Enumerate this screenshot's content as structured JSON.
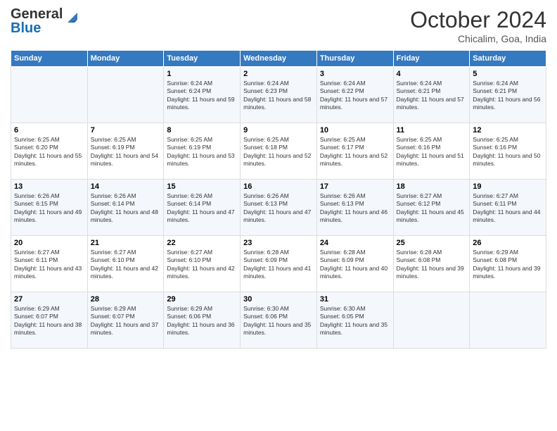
{
  "header": {
    "logo_general": "General",
    "logo_blue": "Blue",
    "month": "October 2024",
    "location": "Chicalim, Goa, India"
  },
  "days_of_week": [
    "Sunday",
    "Monday",
    "Tuesday",
    "Wednesday",
    "Thursday",
    "Friday",
    "Saturday"
  ],
  "weeks": [
    [
      {
        "day": "",
        "detail": ""
      },
      {
        "day": "",
        "detail": ""
      },
      {
        "day": "1",
        "detail": "Sunrise: 6:24 AM\nSunset: 6:24 PM\nDaylight: 11 hours and 59 minutes."
      },
      {
        "day": "2",
        "detail": "Sunrise: 6:24 AM\nSunset: 6:23 PM\nDaylight: 11 hours and 58 minutes."
      },
      {
        "day": "3",
        "detail": "Sunrise: 6:24 AM\nSunset: 6:22 PM\nDaylight: 11 hours and 57 minutes."
      },
      {
        "day": "4",
        "detail": "Sunrise: 6:24 AM\nSunset: 6:21 PM\nDaylight: 11 hours and 57 minutes."
      },
      {
        "day": "5",
        "detail": "Sunrise: 6:24 AM\nSunset: 6:21 PM\nDaylight: 11 hours and 56 minutes."
      }
    ],
    [
      {
        "day": "6",
        "detail": "Sunrise: 6:25 AM\nSunset: 6:20 PM\nDaylight: 11 hours and 55 minutes."
      },
      {
        "day": "7",
        "detail": "Sunrise: 6:25 AM\nSunset: 6:19 PM\nDaylight: 11 hours and 54 minutes."
      },
      {
        "day": "8",
        "detail": "Sunrise: 6:25 AM\nSunset: 6:19 PM\nDaylight: 11 hours and 53 minutes."
      },
      {
        "day": "9",
        "detail": "Sunrise: 6:25 AM\nSunset: 6:18 PM\nDaylight: 11 hours and 52 minutes."
      },
      {
        "day": "10",
        "detail": "Sunrise: 6:25 AM\nSunset: 6:17 PM\nDaylight: 11 hours and 52 minutes."
      },
      {
        "day": "11",
        "detail": "Sunrise: 6:25 AM\nSunset: 6:16 PM\nDaylight: 11 hours and 51 minutes."
      },
      {
        "day": "12",
        "detail": "Sunrise: 6:25 AM\nSunset: 6:16 PM\nDaylight: 11 hours and 50 minutes."
      }
    ],
    [
      {
        "day": "13",
        "detail": "Sunrise: 6:26 AM\nSunset: 6:15 PM\nDaylight: 11 hours and 49 minutes."
      },
      {
        "day": "14",
        "detail": "Sunrise: 6:26 AM\nSunset: 6:14 PM\nDaylight: 11 hours and 48 minutes."
      },
      {
        "day": "15",
        "detail": "Sunrise: 6:26 AM\nSunset: 6:14 PM\nDaylight: 11 hours and 47 minutes."
      },
      {
        "day": "16",
        "detail": "Sunrise: 6:26 AM\nSunset: 6:13 PM\nDaylight: 11 hours and 47 minutes."
      },
      {
        "day": "17",
        "detail": "Sunrise: 6:26 AM\nSunset: 6:13 PM\nDaylight: 11 hours and 46 minutes."
      },
      {
        "day": "18",
        "detail": "Sunrise: 6:27 AM\nSunset: 6:12 PM\nDaylight: 11 hours and 45 minutes."
      },
      {
        "day": "19",
        "detail": "Sunrise: 6:27 AM\nSunset: 6:11 PM\nDaylight: 11 hours and 44 minutes."
      }
    ],
    [
      {
        "day": "20",
        "detail": "Sunrise: 6:27 AM\nSunset: 6:11 PM\nDaylight: 11 hours and 43 minutes."
      },
      {
        "day": "21",
        "detail": "Sunrise: 6:27 AM\nSunset: 6:10 PM\nDaylight: 11 hours and 42 minutes."
      },
      {
        "day": "22",
        "detail": "Sunrise: 6:27 AM\nSunset: 6:10 PM\nDaylight: 11 hours and 42 minutes."
      },
      {
        "day": "23",
        "detail": "Sunrise: 6:28 AM\nSunset: 6:09 PM\nDaylight: 11 hours and 41 minutes."
      },
      {
        "day": "24",
        "detail": "Sunrise: 6:28 AM\nSunset: 6:09 PM\nDaylight: 11 hours and 40 minutes."
      },
      {
        "day": "25",
        "detail": "Sunrise: 6:28 AM\nSunset: 6:08 PM\nDaylight: 11 hours and 39 minutes."
      },
      {
        "day": "26",
        "detail": "Sunrise: 6:29 AM\nSunset: 6:08 PM\nDaylight: 11 hours and 39 minutes."
      }
    ],
    [
      {
        "day": "27",
        "detail": "Sunrise: 6:29 AM\nSunset: 6:07 PM\nDaylight: 11 hours and 38 minutes."
      },
      {
        "day": "28",
        "detail": "Sunrise: 6:29 AM\nSunset: 6:07 PM\nDaylight: 11 hours and 37 minutes."
      },
      {
        "day": "29",
        "detail": "Sunrise: 6:29 AM\nSunset: 6:06 PM\nDaylight: 11 hours and 36 minutes."
      },
      {
        "day": "30",
        "detail": "Sunrise: 6:30 AM\nSunset: 6:06 PM\nDaylight: 11 hours and 35 minutes."
      },
      {
        "day": "31",
        "detail": "Sunrise: 6:30 AM\nSunset: 6:05 PM\nDaylight: 11 hours and 35 minutes."
      },
      {
        "day": "",
        "detail": ""
      },
      {
        "day": "",
        "detail": ""
      }
    ]
  ]
}
